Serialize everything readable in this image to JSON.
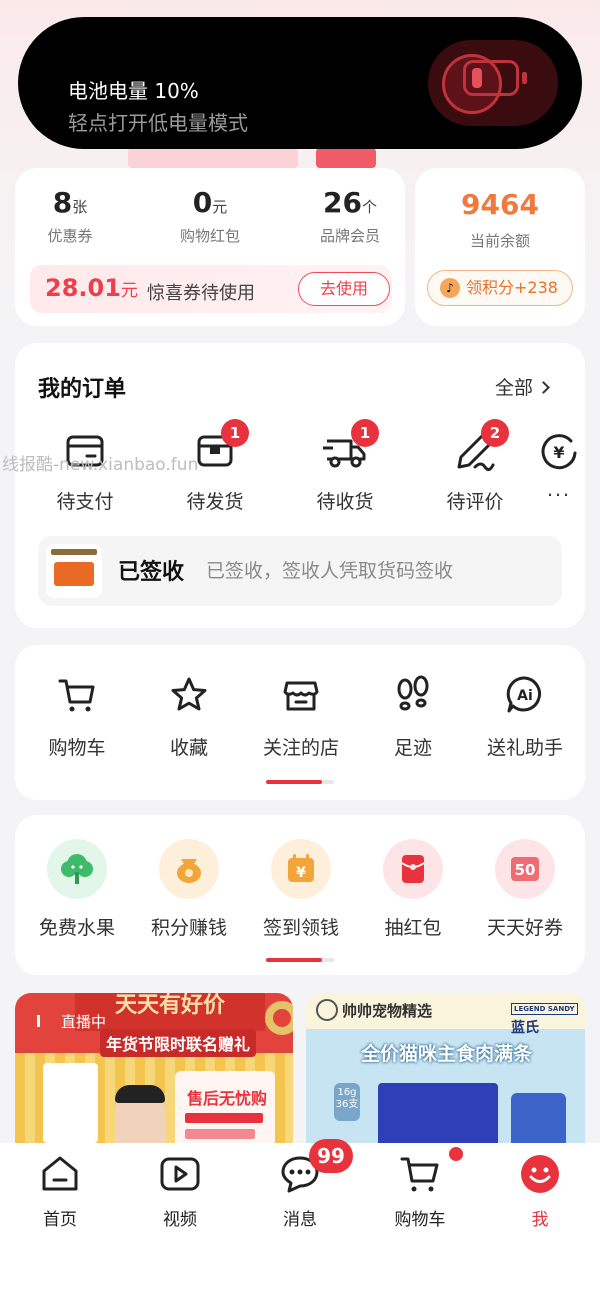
{
  "notification": {
    "title": "电池电量 10%",
    "subtitle": "轻点打开低电量模式"
  },
  "wallet": {
    "stats": [
      {
        "value": "8",
        "unit": "张",
        "label": "优惠券"
      },
      {
        "value": "0",
        "unit": "元",
        "label": "购物红包"
      },
      {
        "value": "26",
        "unit": "个",
        "label": "品牌会员"
      }
    ],
    "coupon": {
      "amount": "28.01",
      "unit": "元",
      "text": "惊喜券待使用",
      "button": "去使用"
    }
  },
  "points": {
    "value": "9464",
    "label": "当前余额",
    "button": "领积分+238",
    "button_icon_glyph": "♪"
  },
  "orders": {
    "title": "我的订单",
    "all": "全部",
    "items": [
      {
        "label": "待支付",
        "icon": "wallet-card-icon",
        "badge": ""
      },
      {
        "label": "待发货",
        "icon": "package-box-icon",
        "badge": "1"
      },
      {
        "label": "待收货",
        "icon": "delivery-truck-icon",
        "badge": "1"
      },
      {
        "label": "待评价",
        "icon": "pen-review-icon",
        "badge": "2"
      }
    ],
    "more_glyph": "¥",
    "more_dots": "...",
    "watermark": "线报酷-new.xianbao.fun",
    "tracking": {
      "status": "已签收",
      "desc": "已签收，签收人凭取货码签收"
    }
  },
  "tools": [
    {
      "label": "购物车",
      "icon": "cart-icon"
    },
    {
      "label": "收藏",
      "icon": "star-icon"
    },
    {
      "label": "关注的店",
      "icon": "shop-icon"
    },
    {
      "label": "足迹",
      "icon": "footprints-icon"
    },
    {
      "label": "送礼助手",
      "icon": "ai-gift-icon",
      "glyph": "Ai"
    }
  ],
  "services": [
    {
      "label": "免费水果",
      "icon": "tree-icon",
      "bg": "#e3f6ea",
      "fg": "#3dbb6a"
    },
    {
      "label": "积分赚钱",
      "icon": "money-bag-icon",
      "bg": "#fdefd9",
      "fg": "#f2a53a"
    },
    {
      "label": "签到领钱",
      "icon": "calendar-yuan-icon",
      "bg": "#fdefd9",
      "fg": "#f2a53a",
      "glyph": "¥"
    },
    {
      "label": "抽红包",
      "icon": "red-envelope-icon",
      "bg": "#fde4e6",
      "fg": "#e8333f"
    },
    {
      "label": "天天好券",
      "icon": "coupon-50-icon",
      "bg": "#fde4e6",
      "fg": "#ee6c74",
      "glyph": "50"
    }
  ],
  "promos": {
    "left": {
      "live": "直播中",
      "banner": "天天有好价",
      "subtitle": "年货节限时联名赠礼",
      "card_title": "售后无忧购"
    },
    "right": {
      "brand": "帅帅宠物精选",
      "partner": "蓝氏",
      "partner_badge": "LEGEND SANDY",
      "slogan": "全价猫咪主食肉满条",
      "chip": "16g 36支"
    }
  },
  "bottom_nav": [
    {
      "label": "首页",
      "icon": "home-icon",
      "active": false
    },
    {
      "label": "视频",
      "icon": "video-play-icon",
      "active": false
    },
    {
      "label": "消息",
      "icon": "chat-bubble-icon",
      "active": false,
      "badge": "99"
    },
    {
      "label": "购物车",
      "icon": "cart-icon",
      "active": false,
      "dot": true
    },
    {
      "label": "我",
      "icon": "smiley-profile-icon",
      "active": true
    }
  ],
  "colors": {
    "accent": "#e8333f",
    "points": "#f07a3e"
  }
}
